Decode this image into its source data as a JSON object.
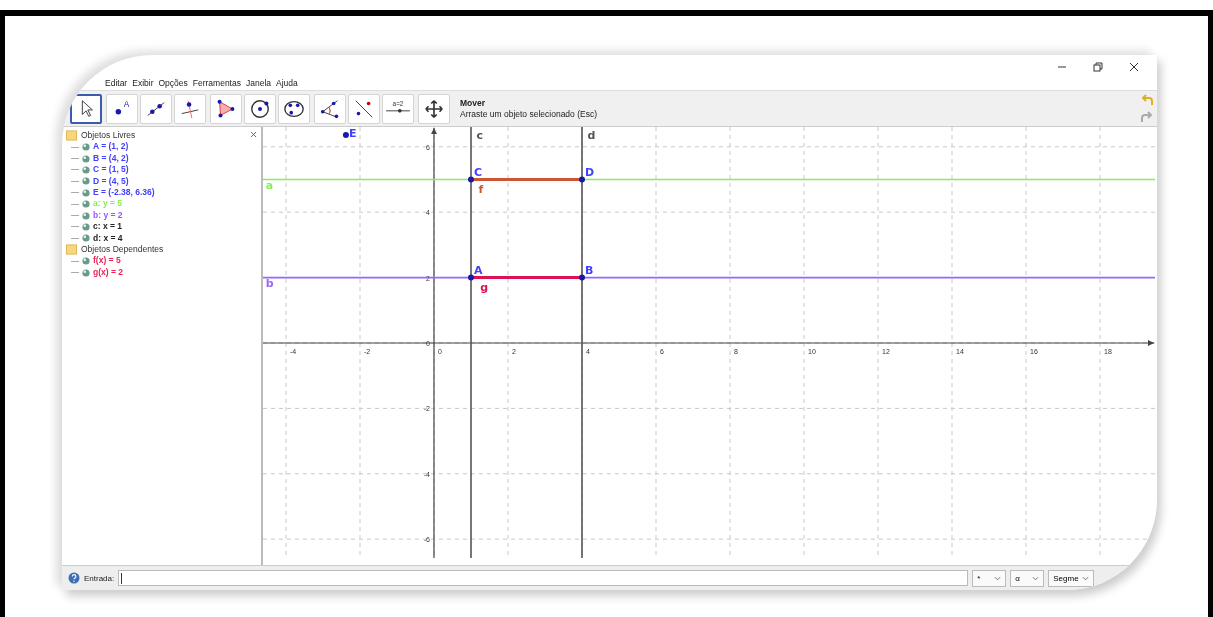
{
  "menu": [
    "Editar",
    "Exibir",
    "Opções",
    "Ferramentas",
    "Janela",
    "Ajuda"
  ],
  "toolbar": {
    "tool_groups": [
      [
        {
          "kind": "move",
          "selected": true
        }
      ],
      [
        {
          "kind": "point",
          "label": "A",
          "selected": false
        },
        {
          "kind": "line",
          "selected": false
        },
        {
          "kind": "perpendicular",
          "selected": false
        }
      ],
      [
        {
          "kind": "polygon",
          "selected": false
        },
        {
          "kind": "circle",
          "selected": false
        },
        {
          "kind": "conic",
          "selected": false
        }
      ],
      [
        {
          "kind": "angle",
          "selected": false
        },
        {
          "kind": "reflect",
          "selected": false
        },
        {
          "kind": "slider",
          "label": "a=2",
          "selected": false
        }
      ],
      [
        {
          "kind": "move_view",
          "selected": false
        }
      ]
    ]
  },
  "tool_help": {
    "title": "Mover",
    "description": "Arraste um objeto selecionado (Esc)"
  },
  "algebra": {
    "folders": [
      {
        "label": "Objetos Livres",
        "children": [
          {
            "text": "A = (1, 2)",
            "color": "#4040ff"
          },
          {
            "text": "B = (4, 2)",
            "color": "#4040ff"
          },
          {
            "text": "C = (1, 5)",
            "color": "#4040ff"
          },
          {
            "text": "D = (4, 5)",
            "color": "#4040ff"
          },
          {
            "text": "E = (-2.38, 6.36)",
            "color": "#4040ff"
          },
          {
            "text": "a: y = 5",
            "color": "#88ee55"
          },
          {
            "text": "b: y = 2",
            "color": "#9955ff"
          },
          {
            "text": "c: x = 1",
            "color": "#222222"
          },
          {
            "text": "d: x = 4",
            "color": "#222222"
          }
        ]
      },
      {
        "label": "Objetos Dependentes",
        "children": [
          {
            "text": "f(x) = 5",
            "color": "#ee2255"
          },
          {
            "text": "g(x) = 2",
            "color": "#ee2255"
          }
        ]
      }
    ]
  },
  "graphics": {
    "x_ticks": [
      "-4",
      "-2",
      "0",
      "2",
      "4",
      "6",
      "8",
      "10",
      "12",
      "14",
      "16",
      "18"
    ],
    "y_ticks": [
      "6",
      "4",
      "2",
      "0",
      "-2",
      "-4",
      "-6"
    ],
    "objects": [
      {
        "kind": "line",
        "label": "a",
        "color": "#88ee55"
      },
      {
        "kind": "line",
        "label": "b",
        "color": "#9966ff"
      },
      {
        "kind": "line",
        "label": "c",
        "color": "#555555"
      },
      {
        "kind": "line",
        "label": "d",
        "color": "#555555"
      },
      {
        "kind": "segment",
        "label": "f",
        "color": "#cc5533"
      },
      {
        "kind": "segment",
        "label": "g",
        "color": "#dd1155"
      },
      {
        "kind": "point",
        "label": "E",
        "color": "#1a1aaa"
      },
      {
        "kind": "point",
        "label": "C",
        "color": "#1a1aaa"
      },
      {
        "kind": "point",
        "label": "D",
        "color": "#1a1aaa"
      },
      {
        "kind": "point",
        "label": "A",
        "color": "#1a1aaa"
      },
      {
        "kind": "point",
        "label": "B",
        "color": "#1a1aaa"
      }
    ]
  },
  "input_bar": {
    "label": "Entrada:",
    "dropdowns": [
      "*",
      "α",
      "Segme"
    ]
  }
}
